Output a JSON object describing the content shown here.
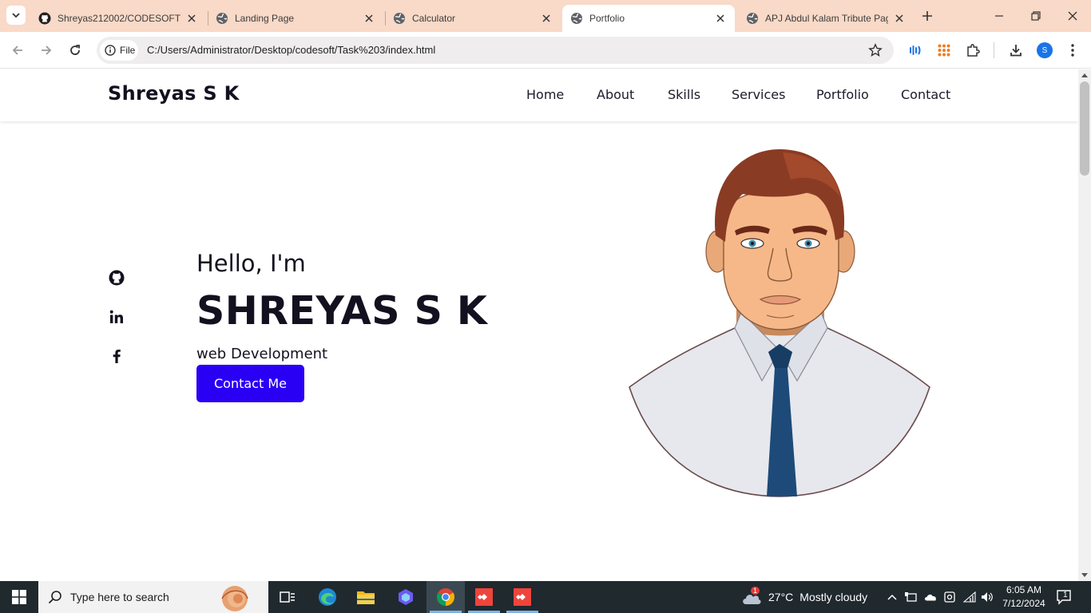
{
  "browser": {
    "tabs": [
      {
        "title": "Shreyas212002/CODESOFT_",
        "favicon": "github-icon",
        "active": false
      },
      {
        "title": "Landing Page",
        "favicon": "globe-icon",
        "active": false
      },
      {
        "title": "Calculator",
        "favicon": "globe-icon",
        "active": false
      },
      {
        "title": "Portfolio",
        "favicon": "globe-icon",
        "active": true
      },
      {
        "title": "APJ Abdul Kalam Tribute Pag",
        "favicon": "globe-icon",
        "active": false
      }
    ],
    "chip_label": "File",
    "url": "C:/Users/Administrator/Desktop/codesoft/Task%203/index.html",
    "profile_initial": "S",
    "colors": {
      "tabstrip": "#f9d9c7"
    }
  },
  "site": {
    "logo": "Shreyas S K",
    "nav": [
      "Home",
      "About",
      "Skills",
      "Services",
      "Portfolio",
      "Contact"
    ],
    "social_icons": [
      "github-icon",
      "linkedin-icon",
      "facebook-icon"
    ],
    "hero": {
      "greeting": "Hello, I'm",
      "name": "SHREYAS S K",
      "role": "web Development",
      "button": "Contact Me"
    },
    "colors": {
      "accent": "#2a00f5",
      "text": "#13111f"
    }
  },
  "taskbar": {
    "search_placeholder": "Type here to search",
    "weather": {
      "badge": "1",
      "temperature": "27°C",
      "condition": "Mostly cloudy"
    },
    "time": "6:05 AM",
    "date": "7/12/2024",
    "notifications": "1"
  }
}
